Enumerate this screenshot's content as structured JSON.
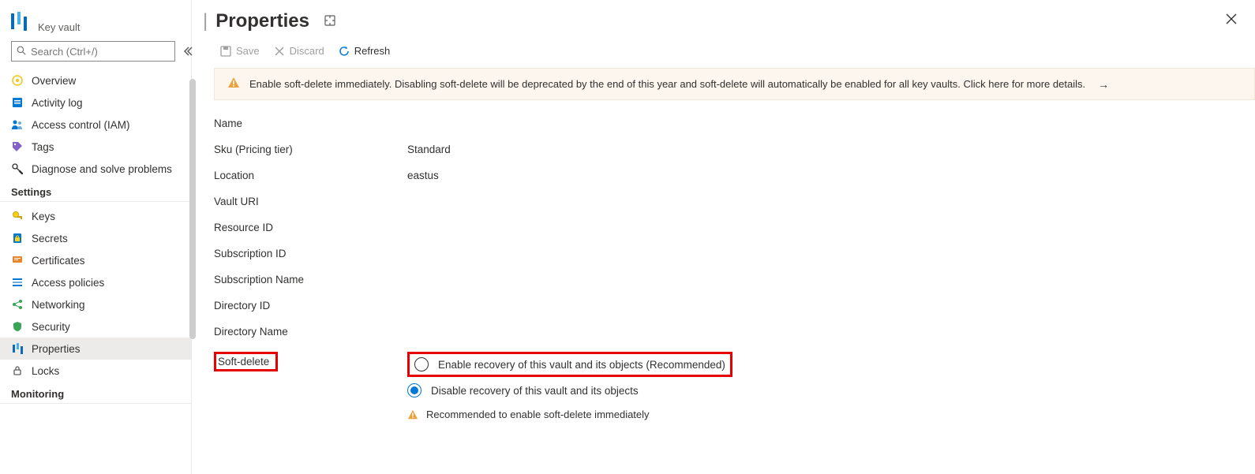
{
  "sidebar": {
    "subtitle": "Key vault",
    "search_placeholder": "Search (Ctrl+/)",
    "top_items": [
      {
        "label": "Overview"
      },
      {
        "label": "Activity log"
      },
      {
        "label": "Access control (IAM)"
      },
      {
        "label": "Tags"
      },
      {
        "label": "Diagnose and solve problems"
      }
    ],
    "section_settings": "Settings",
    "settings_items": [
      {
        "label": "Keys"
      },
      {
        "label": "Secrets"
      },
      {
        "label": "Certificates"
      },
      {
        "label": "Access policies"
      },
      {
        "label": "Networking"
      },
      {
        "label": "Security"
      },
      {
        "label": "Properties"
      },
      {
        "label": "Locks"
      }
    ],
    "section_monitoring": "Monitoring"
  },
  "header": {
    "title": "Properties"
  },
  "toolbar": {
    "save": "Save",
    "discard": "Discard",
    "refresh": "Refresh"
  },
  "banner": {
    "text": "Enable soft-delete immediately. Disabling soft-delete will be deprecated by the end of this year and soft-delete will automatically be enabled for all key vaults. Click here for more details."
  },
  "properties": {
    "name_label": "Name",
    "name_value": "",
    "sku_label": "Sku (Pricing tier)",
    "sku_value": "Standard",
    "location_label": "Location",
    "location_value": "eastus",
    "vault_uri_label": "Vault URI",
    "resource_id_label": "Resource ID",
    "subscription_id_label": "Subscription ID",
    "subscription_name_label": "Subscription Name",
    "directory_id_label": "Directory ID",
    "directory_name_label": "Directory Name",
    "softdelete_label": "Soft-delete",
    "softdelete_enable": "Enable recovery of this vault and its objects (Recommended)",
    "softdelete_disable": "Disable recovery of this vault and its objects",
    "softdelete_warn": "Recommended to enable soft-delete immediately"
  }
}
